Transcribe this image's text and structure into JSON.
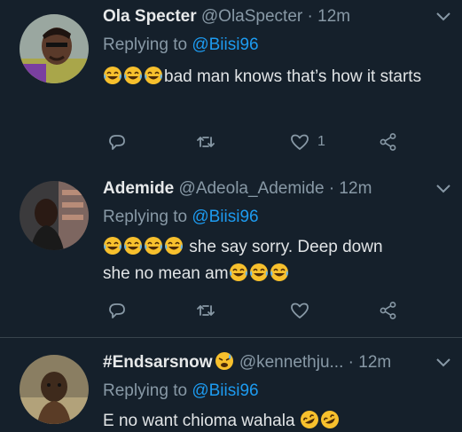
{
  "tweets": [
    {
      "name": "Ola Specter",
      "handle": "@OlaSpecter",
      "time": "· 12m",
      "replying_prefix": "Replying to ",
      "replying_to": "@Biisi96",
      "text": "bad man knows that’s how it starts",
      "likes": "1"
    },
    {
      "name": "Ademide",
      "handle": "@Adeola_Ademide",
      "time": "· 12m",
      "replying_prefix": "Replying to ",
      "replying_to": "@Biisi96",
      "text_line1": "she say sorry. Deep down",
      "text_line2": "she no mean am",
      "likes": ""
    },
    {
      "name": "#Endsarsnow",
      "handle": "@kennethju...",
      "time": "· 12m",
      "replying_prefix": "Replying to ",
      "replying_to": "@Biisi96",
      "text": "E no want chioma wahala"
    }
  ],
  "icons": {
    "reply": "reply-icon",
    "retweet": "retweet-icon",
    "like": "heart-icon",
    "share": "share-icon",
    "more": "chevron-down-icon",
    "emoji_laugh": "tears-of-joy-emoji",
    "emoji_sad": "disappointed-relieved-emoji",
    "emoji_rofl": "rolling-laughing-emoji"
  },
  "colors": {
    "background": "#15202b",
    "secondary_text": "#8899a6",
    "accent": "#1d9bf0",
    "divider": "#38444d"
  }
}
